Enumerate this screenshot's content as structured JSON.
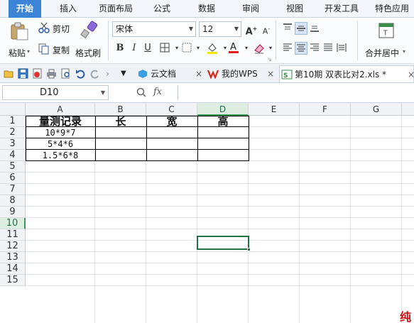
{
  "menu": {
    "tabs": [
      "开始",
      "插入",
      "页面布局",
      "公式",
      "数据",
      "审阅",
      "视图",
      "开发工具",
      "特色应用"
    ],
    "active": "开始"
  },
  "ribbon": {
    "paste_label": "粘贴",
    "cut_label": "剪切",
    "copy_label": "复制",
    "format_painter_label": "格式刷",
    "font_name": "宋体",
    "font_size": "12",
    "merge_center_label": "合并居中"
  },
  "quickbar": {
    "cloud_docs_label": "云文档",
    "my_wps_label": "我的WPS",
    "doc_tab_label": "第10期 双表比对2.xls *"
  },
  "formula_bar": {
    "name_box": "D10",
    "fx_label": "fx",
    "formula": ""
  },
  "sheet": {
    "columns": [
      "A",
      "B",
      "C",
      "D",
      "E",
      "F",
      "G"
    ],
    "rows": [
      "1",
      "2",
      "3",
      "4",
      "5",
      "6",
      "7",
      "8",
      "9",
      "10",
      "11",
      "12",
      "13",
      "14",
      "15"
    ],
    "selected_column": "D",
    "selected_row": "10",
    "header_row": [
      "量测记录",
      "长",
      "宽",
      "高"
    ],
    "data_rows": [
      [
        "10*9*7",
        "",
        "",
        ""
      ],
      [
        "5*4*6",
        "",
        "",
        ""
      ],
      [
        "1.5*6*8",
        "",
        "",
        ""
      ]
    ]
  },
  "watermark_char": "纯",
  "colors": {
    "accent_blue": "#3c84d6",
    "selection_green": "#217346"
  }
}
